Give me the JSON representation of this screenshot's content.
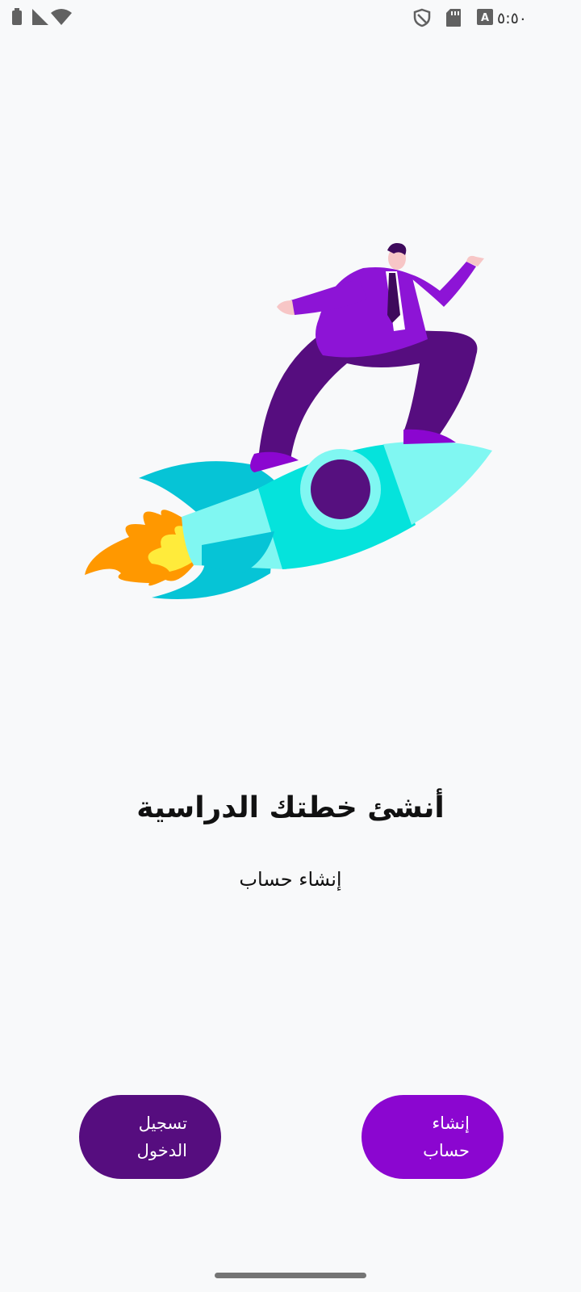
{
  "status_bar": {
    "time": "٥:٥٠",
    "icons": [
      "battery-icon",
      "signal-icon",
      "wifi-icon",
      "shield-icon",
      "sd-card-icon",
      "keyboard-a-icon"
    ]
  },
  "illustration": {
    "description_icon": "rocket-businessman-illustration",
    "colors": {
      "suit": "#8d14d6",
      "pants": "#560d7f",
      "rocket_main": "#05e3dc",
      "rocket_light": "#80f7f2",
      "rocket_fins": "#06c4d6",
      "window": "#56107f",
      "flame_outer": "#ff9800",
      "flame_inner": "#ffeb3b"
    }
  },
  "main": {
    "title": "أنشئ خطتك الدراسية",
    "subtitle": "إنشاء حساب"
  },
  "buttons": {
    "login_label": "تسجيل\nالدخول",
    "create_label": "إنشاء\nحساب"
  },
  "colors": {
    "background": "#f8f9fa",
    "login_button": "#560d7f",
    "create_button": "#8b06d0"
  }
}
